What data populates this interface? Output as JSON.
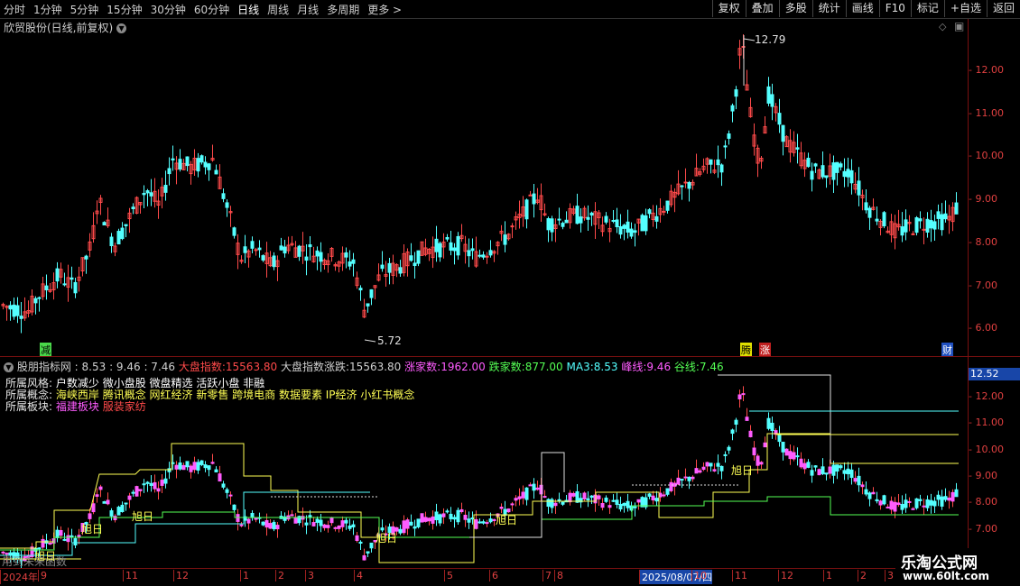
{
  "toolbar": {
    "periods": [
      "分时",
      "1分钟",
      "5分钟",
      "15分钟",
      "30分钟",
      "60分钟",
      "日线",
      "周线",
      "月线",
      "多周期",
      "更多"
    ],
    "active_period": "日线",
    "buttons": [
      "复权",
      "叠加",
      "多股",
      "统计",
      "画线",
      "F10",
      "标记",
      "+自选",
      "返回"
    ]
  },
  "main": {
    "title": "欣贸股份(日线,前复权)",
    "price_axis": [
      "12.00",
      "11.00",
      "10.00",
      "9.00",
      "8.00",
      "7.00",
      "6.00"
    ],
    "high_label": "12.79",
    "low_label": "5.72",
    "markers": [
      "减",
      "腾",
      "涨",
      "财"
    ]
  },
  "indicator": {
    "name": "股朋指标网",
    "values": ": 8.53 : 9.46 : 7.46",
    "dapan_label": "大盘指数:",
    "dapan_value": "15563.80",
    "zhangdie_label": "大盘指数涨跌:",
    "zhangdie_value": "15563.80",
    "zhang_label": "涨家数:",
    "zhang_value": "1962.00",
    "die_label": "跌家数:",
    "die_value": "877.00",
    "ma3_label": "MA3:",
    "ma3_value": "8.53",
    "feng_label": "峰线:",
    "feng_value": "9.46",
    "gu_label": "谷线:",
    "gu_value": "7.46",
    "style_label": "所属风格:",
    "style_value": "户数减少 微小盘股 微盘精选 活跃小盘 非融",
    "concept_label": "所属概念:",
    "concept_value": "海峡西岸 腾讯概念 网红经济 新零售 跨境电商 数据要素 IP经济 小红书概念",
    "sector_label": "所属板块:",
    "sector_value_1": "福建板块",
    "sector_value_2": "服装家纺",
    "axis": [
      "12.00",
      "11.00",
      "10.00",
      "9.00",
      "8.00",
      "7.00"
    ],
    "current": "12.52",
    "signal": "旭日",
    "footnote": "用到未来函数"
  },
  "dates": [
    "2024年",
    "9",
    "11",
    "12",
    "1",
    "2",
    "3",
    "4",
    "5",
    "6",
    "7",
    "8",
    "2025/08/07/四",
    "10",
    "11",
    "12",
    "1",
    "2",
    "3"
  ],
  "watermark": {
    "title": "乐淘公式网",
    "url": "www.60lt.com"
  },
  "colors": {
    "up": "#ff4a4a",
    "down": "#54ffff",
    "magenta": "#ff5cff",
    "yellow": "#ffff54",
    "green": "#54ff54",
    "axis": "#c83030"
  }
}
